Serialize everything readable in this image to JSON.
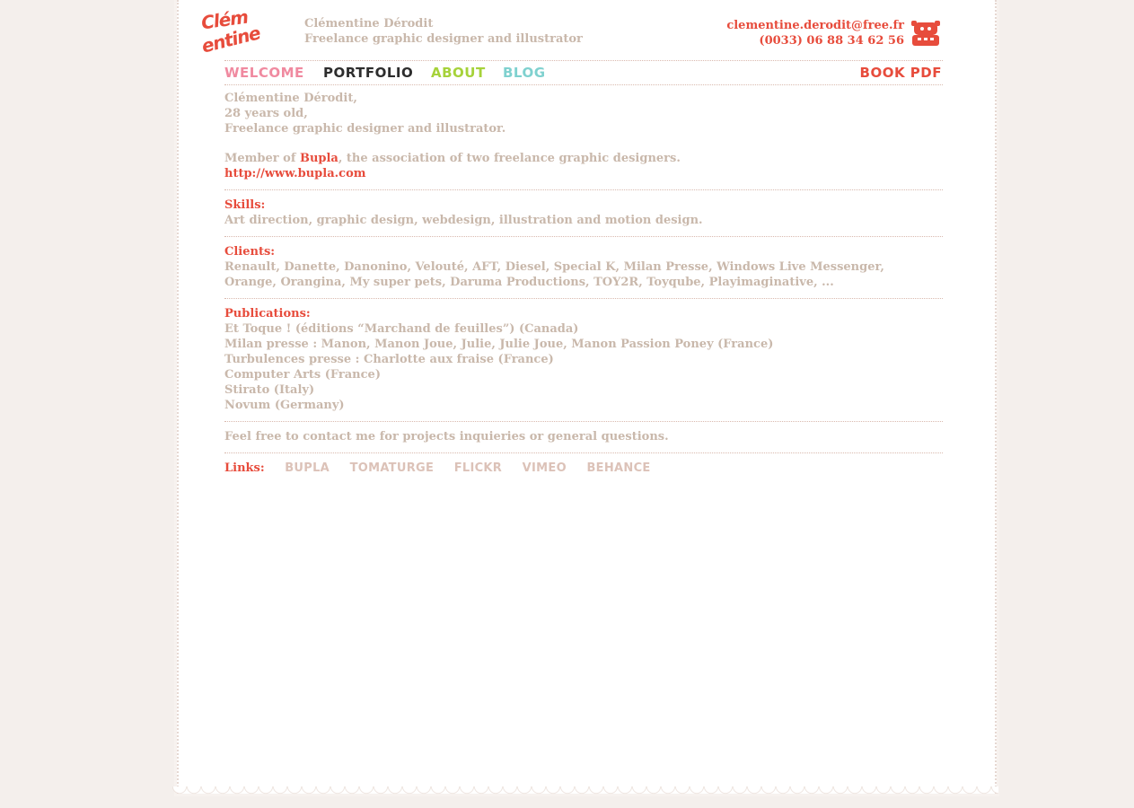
{
  "header": {
    "logo_line1": "Clém",
    "logo_line2": "entine",
    "name": "Clémentine Dérodit",
    "subtitle": "Freelance graphic designer and illustrator",
    "email": "clementine.derodit@free.fr",
    "phone": "(0033) 06 88 34 62 56"
  },
  "nav": {
    "welcome": "WELCOME",
    "portfolio": "PORTFOLIO",
    "about": "ABOUT",
    "blog": "BLOG",
    "book_pdf": "BOOK PDF"
  },
  "intro": {
    "line1": "Clémentine Dérodit,",
    "line2": "28 years old,",
    "line3": "Freelance graphic designer and illustrator.",
    "member_prefix": "Member of ",
    "member_link": "Bupla",
    "member_suffix": ", the association of two freelance graphic designers.",
    "url": "http://www.bupla.com"
  },
  "skills": {
    "title": "Skills:",
    "text": "Art direction, graphic design, webdesign, illustration and motion design."
  },
  "clients": {
    "title": "Clients:",
    "line1": "Renault, Danette, Danonino, Velouté, AFT, Diesel, Special K, Milan Presse, Windows Live Messenger,",
    "line2": "Orange, Orangina, My super pets, Daruma Productions, TOY2R, Toyqube, Playimaginative, ..."
  },
  "publications": {
    "title": "Publications:",
    "items": [
      "Et Toque ! (éditions “Marchand de feuilles”) (Canada)",
      "Milan presse : Manon, Manon Joue, Julie, Julie Joue, Manon Passion Poney (France)",
      "Turbulences presse : Charlotte aux fraise (France)",
      "Computer Arts (France)",
      "Stirato (Italy)",
      "Novum (Germany)"
    ]
  },
  "contact_note": "Feel free to contact me for projects inquieries or general questions.",
  "links": {
    "label": "Links:",
    "items": [
      "BUPLA",
      "TOMATURGE",
      "FLICKR",
      "VIMEO",
      "BEHANCE"
    ]
  },
  "colors": {
    "accent_red": "#e74c3c",
    "text_beige": "#c9b8ab",
    "welcome_pink": "#f08aa0",
    "portfolio_dark": "#2d2d2d",
    "about_green": "#a6d23a",
    "blog_teal": "#7fd1cf",
    "link_beige": "#dcc2b8"
  },
  "icons": {
    "logo": "clementine-logo",
    "phone": "phone-robot-icon"
  }
}
